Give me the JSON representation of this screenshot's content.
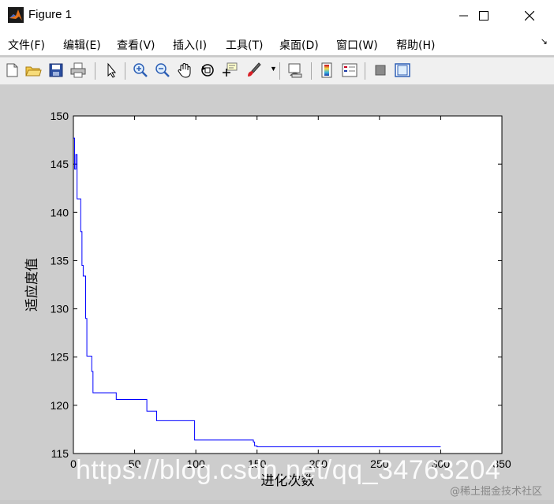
{
  "window": {
    "title": "Figure 1"
  },
  "menu": [
    {
      "label": "文件(F)"
    },
    {
      "label": "编辑(E)"
    },
    {
      "label": "查看(V)"
    },
    {
      "label": "插入(I)"
    },
    {
      "label": "工具(T)"
    },
    {
      "label": "桌面(D)"
    },
    {
      "label": "窗口(W)"
    },
    {
      "label": "帮助(H)"
    }
  ],
  "toolbar_icons": [
    "new-figure-icon",
    "open-file-icon",
    "save-icon",
    "print-icon",
    "edit-plot-arrow-icon",
    "zoom-in-icon",
    "zoom-out-icon",
    "pan-hand-icon",
    "rotate-3d-icon",
    "data-cursor-icon",
    "brush-icon",
    "link-plot-icon",
    "colorbar-icon",
    "legend-icon",
    "hide-plot-tools-icon",
    "show-plot-tools-icon"
  ],
  "chart_data": {
    "type": "line",
    "xlabel": "进化次数",
    "ylabel": "适应度值",
    "xlim": [
      0,
      350
    ],
    "ylim": [
      115,
      150
    ],
    "xticks": [
      0,
      50,
      100,
      150,
      200,
      250,
      300,
      350
    ],
    "yticks": [
      115,
      120,
      125,
      130,
      135,
      140,
      145,
      150
    ],
    "grid": false,
    "series": [
      {
        "color": "#0000ff",
        "step": true,
        "x": [
          0,
          1,
          2,
          3,
          6,
          7,
          8,
          10,
          11,
          12,
          15,
          16,
          17,
          18,
          30,
          35,
          58,
          60,
          67,
          68,
          70,
          98,
          99,
          100,
          147,
          148,
          150,
          300
        ],
        "y": [
          147.7,
          144.5,
          146.0,
          141.4,
          138.0,
          134.5,
          133.4,
          129.0,
          125.1,
          125.1,
          123.5,
          121.3,
          121.3,
          121.3,
          121.3,
          120.6,
          120.6,
          119.4,
          119.4,
          118.4,
          118.4,
          118.4,
          116.4,
          116.4,
          116.2,
          115.8,
          115.7,
          115.7
        ]
      }
    ]
  },
  "watermark": "https://blog.csdn.net/qq_34763204",
  "brand": "@稀土掘金技术社区"
}
